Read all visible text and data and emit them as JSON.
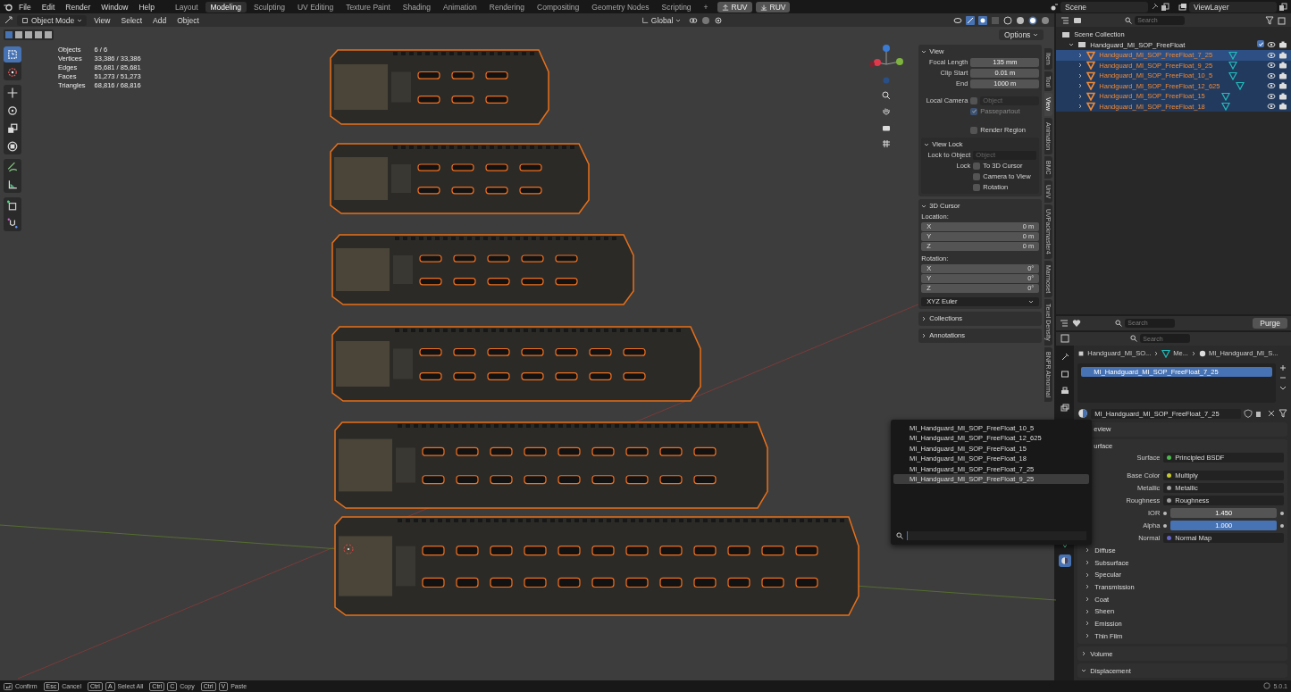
{
  "menu": [
    "File",
    "Edit",
    "Render",
    "Window",
    "Help"
  ],
  "workspaces": [
    {
      "label": "Layout",
      "selected": false
    },
    {
      "label": "Modeling",
      "selected": true
    },
    {
      "label": "Sculpting",
      "selected": false
    },
    {
      "label": "UV Editing",
      "selected": false
    },
    {
      "label": "Texture Paint",
      "selected": false
    },
    {
      "label": "Shading",
      "selected": false
    },
    {
      "label": "Animation",
      "selected": false
    },
    {
      "label": "Rendering",
      "selected": false
    },
    {
      "label": "Compositing",
      "selected": false
    },
    {
      "label": "Geometry Nodes",
      "selected": false
    },
    {
      "label": "Scripting",
      "selected": false
    }
  ],
  "add_workspace": "+",
  "ruv_buttons": [
    {
      "label": "RUV",
      "kind": "upload"
    },
    {
      "label": "RUV",
      "kind": "download"
    }
  ],
  "scene": "Scene",
  "view_layer": "ViewLayer",
  "viewport": {
    "mode": "Object Mode",
    "menus": [
      "View",
      "Select",
      "Add",
      "Object"
    ],
    "orientation": "Global",
    "options": "Options",
    "stats": [
      {
        "label": "Objects",
        "value": "6 / 6"
      },
      {
        "label": "Vertices",
        "value": "33,386 / 33,386"
      },
      {
        "label": "Edges",
        "value": "85,681 / 85,681"
      },
      {
        "label": "Faces",
        "value": "51,273 / 51,273"
      },
      {
        "label": "Triangles",
        "value": "68,816 / 68,816"
      }
    ]
  },
  "n_panel": {
    "tabs": [
      {
        "label": "Item",
        "selected": false
      },
      {
        "label": "Tool",
        "selected": false
      },
      {
        "label": "View",
        "selected": true
      },
      {
        "label": "Animation",
        "selected": false
      },
      {
        "label": "BMC",
        "selected": false
      },
      {
        "label": "UniV",
        "selected": false
      },
      {
        "label": "UVPackmaster4",
        "selected": false
      },
      {
        "label": "Marmoset",
        "selected": false
      },
      {
        "label": "Texel Density",
        "selected": false
      },
      {
        "label": "BNPR Abnormal",
        "selected": false
      }
    ],
    "view": {
      "title": "View",
      "fields": [
        {
          "label": "Focal Length",
          "value": "135 mm"
        },
        {
          "label": "Clip Start",
          "value": "0.01 m"
        },
        {
          "label": "End",
          "value": "1000 m"
        }
      ],
      "local_camera": {
        "label": "Local Camera",
        "checked": false,
        "placeholder": "Object"
      },
      "checks": [
        {
          "label": "Passepartout",
          "checked": true,
          "disabled": true
        },
        {
          "label": "Render Region",
          "checked": false,
          "disabled": false
        }
      ],
      "view_lock": {
        "title": "View Lock",
        "lock_to_object": {
          "label": "Lock to Object",
          "placeholder": "Object"
        },
        "lock_label": "Lock",
        "checks": [
          {
            "label": "To 3D Cursor",
            "checked": false
          },
          {
            "label": "Camera to View",
            "checked": false
          },
          {
            "label": "Rotation",
            "checked": false
          }
        ]
      }
    },
    "cursor": {
      "title": "3D Cursor",
      "location_label": "Location:",
      "location": [
        {
          "axis": "X",
          "value": "0 m"
        },
        {
          "axis": "Y",
          "value": "0 m"
        },
        {
          "axis": "Z",
          "value": "0 m"
        }
      ],
      "rotation_label": "Rotation:",
      "rotation": [
        {
          "axis": "X",
          "value": "0°"
        },
        {
          "axis": "Y",
          "value": "0°"
        },
        {
          "axis": "Z",
          "value": "0°"
        }
      ],
      "rotation_mode": "XYZ Euler"
    },
    "collapsed_panels": [
      "Collections",
      "Annotations"
    ]
  },
  "outliner": {
    "search_placeholder": "Search",
    "root": "Scene Collection",
    "collection": {
      "name": "Handguard_MI_SOP_FreeFloat",
      "checked": true,
      "expanded": true,
      "children": [
        {
          "name": "Handguard_MI_SOP_FreeFloat_7_25",
          "selected": true,
          "active": true
        },
        {
          "name": "Handguard_MI_SOP_FreeFloat_9_25",
          "selected": true,
          "active": false
        },
        {
          "name": "Handguard_MI_SOP_FreeFloat_10_5",
          "selected": true,
          "active": false
        },
        {
          "name": "Handguard_MI_SOP_FreeFloat_12_625",
          "selected": true,
          "active": false
        },
        {
          "name": "Handguard_MI_SOP_FreeFloat_15",
          "selected": true,
          "active": false
        },
        {
          "name": "Handguard_MI_SOP_FreeFloat_18",
          "selected": true,
          "active": false
        }
      ]
    }
  },
  "data_browser": {
    "search_placeholder": "Search",
    "purge": "Purge"
  },
  "properties": {
    "search_placeholder": "Search",
    "breadcrumb": [
      "Handguard_MI_SO...",
      "Me...",
      "MI_Handguard_MI_S..."
    ],
    "slots": [
      {
        "name": "MI_Handguard_MI_SOP_FreeFloat_7_25",
        "selected": true
      }
    ],
    "material": "MI_Handguard_MI_SOP_FreeFloat_7_25",
    "preview_title": "eview",
    "surface_title": "urface",
    "rows": [
      {
        "label": "Surface",
        "kind": "link",
        "value": "Principled BSDF",
        "color": "#4cb84c"
      },
      {
        "label": "Base Color",
        "kind": "link",
        "value": "Multiply",
        "color": "#c8c832"
      },
      {
        "label": "Metallic",
        "kind": "link",
        "value": "Metallic",
        "color": "#a0a0a0"
      },
      {
        "label": "Roughness",
        "kind": "link",
        "value": "Roughness",
        "color": "#a0a0a0"
      },
      {
        "label": "IOR",
        "kind": "number",
        "value": "1.450"
      },
      {
        "label": "Alpha",
        "kind": "slider",
        "value": "1.000",
        "level": 1
      },
      {
        "label": "Normal",
        "kind": "link",
        "value": "Normal Map",
        "color": "#6464c8"
      }
    ],
    "subpanels": [
      {
        "title": "Diffuse",
        "expanded": false
      },
      {
        "title": "Subsurface",
        "expanded": false
      },
      {
        "title": "Specular",
        "expanded": false
      },
      {
        "title": "Transmission",
        "expanded": false
      },
      {
        "title": "Coat",
        "expanded": false
      },
      {
        "title": "Sheen",
        "expanded": false
      },
      {
        "title": "Emission",
        "expanded": false
      },
      {
        "title": "Thin Film",
        "expanded": false
      }
    ],
    "panels": [
      {
        "title": "Volume",
        "expanded": false
      },
      {
        "title": "Displacement",
        "expanded": true
      }
    ]
  },
  "dropdown": {
    "items": [
      {
        "label": "MI_Handguard_MI_SOP_FreeFloat_10_5",
        "selected": false
      },
      {
        "label": "MI_Handguard_MI_SOP_FreeFloat_12_625",
        "selected": false
      },
      {
        "label": "MI_Handguard_MI_SOP_FreeFloat_15",
        "selected": false
      },
      {
        "label": "MI_Handguard_MI_SOP_FreeFloat_18",
        "selected": false
      },
      {
        "label": "MI_Handguard_MI_SOP_FreeFloat_7_25",
        "selected": false
      },
      {
        "label": "MI_Handguard_MI_SOP_FreeFloat_9_25",
        "selected": true
      }
    ]
  },
  "status": {
    "hints": [
      {
        "kind": "enter",
        "label": "Confirm"
      },
      {
        "kind": "keys",
        "keys": [
          "Esc"
        ],
        "label": "Cancel"
      },
      {
        "kind": "keys",
        "keys": [
          "Ctrl",
          "A"
        ],
        "label": "Select All"
      },
      {
        "kind": "keys",
        "keys": [
          "Ctrl",
          "C"
        ],
        "label": "Copy"
      },
      {
        "kind": "keys",
        "keys": [
          "Ctrl",
          "V"
        ],
        "label": "Paste"
      }
    ],
    "version": "5.0.1"
  }
}
